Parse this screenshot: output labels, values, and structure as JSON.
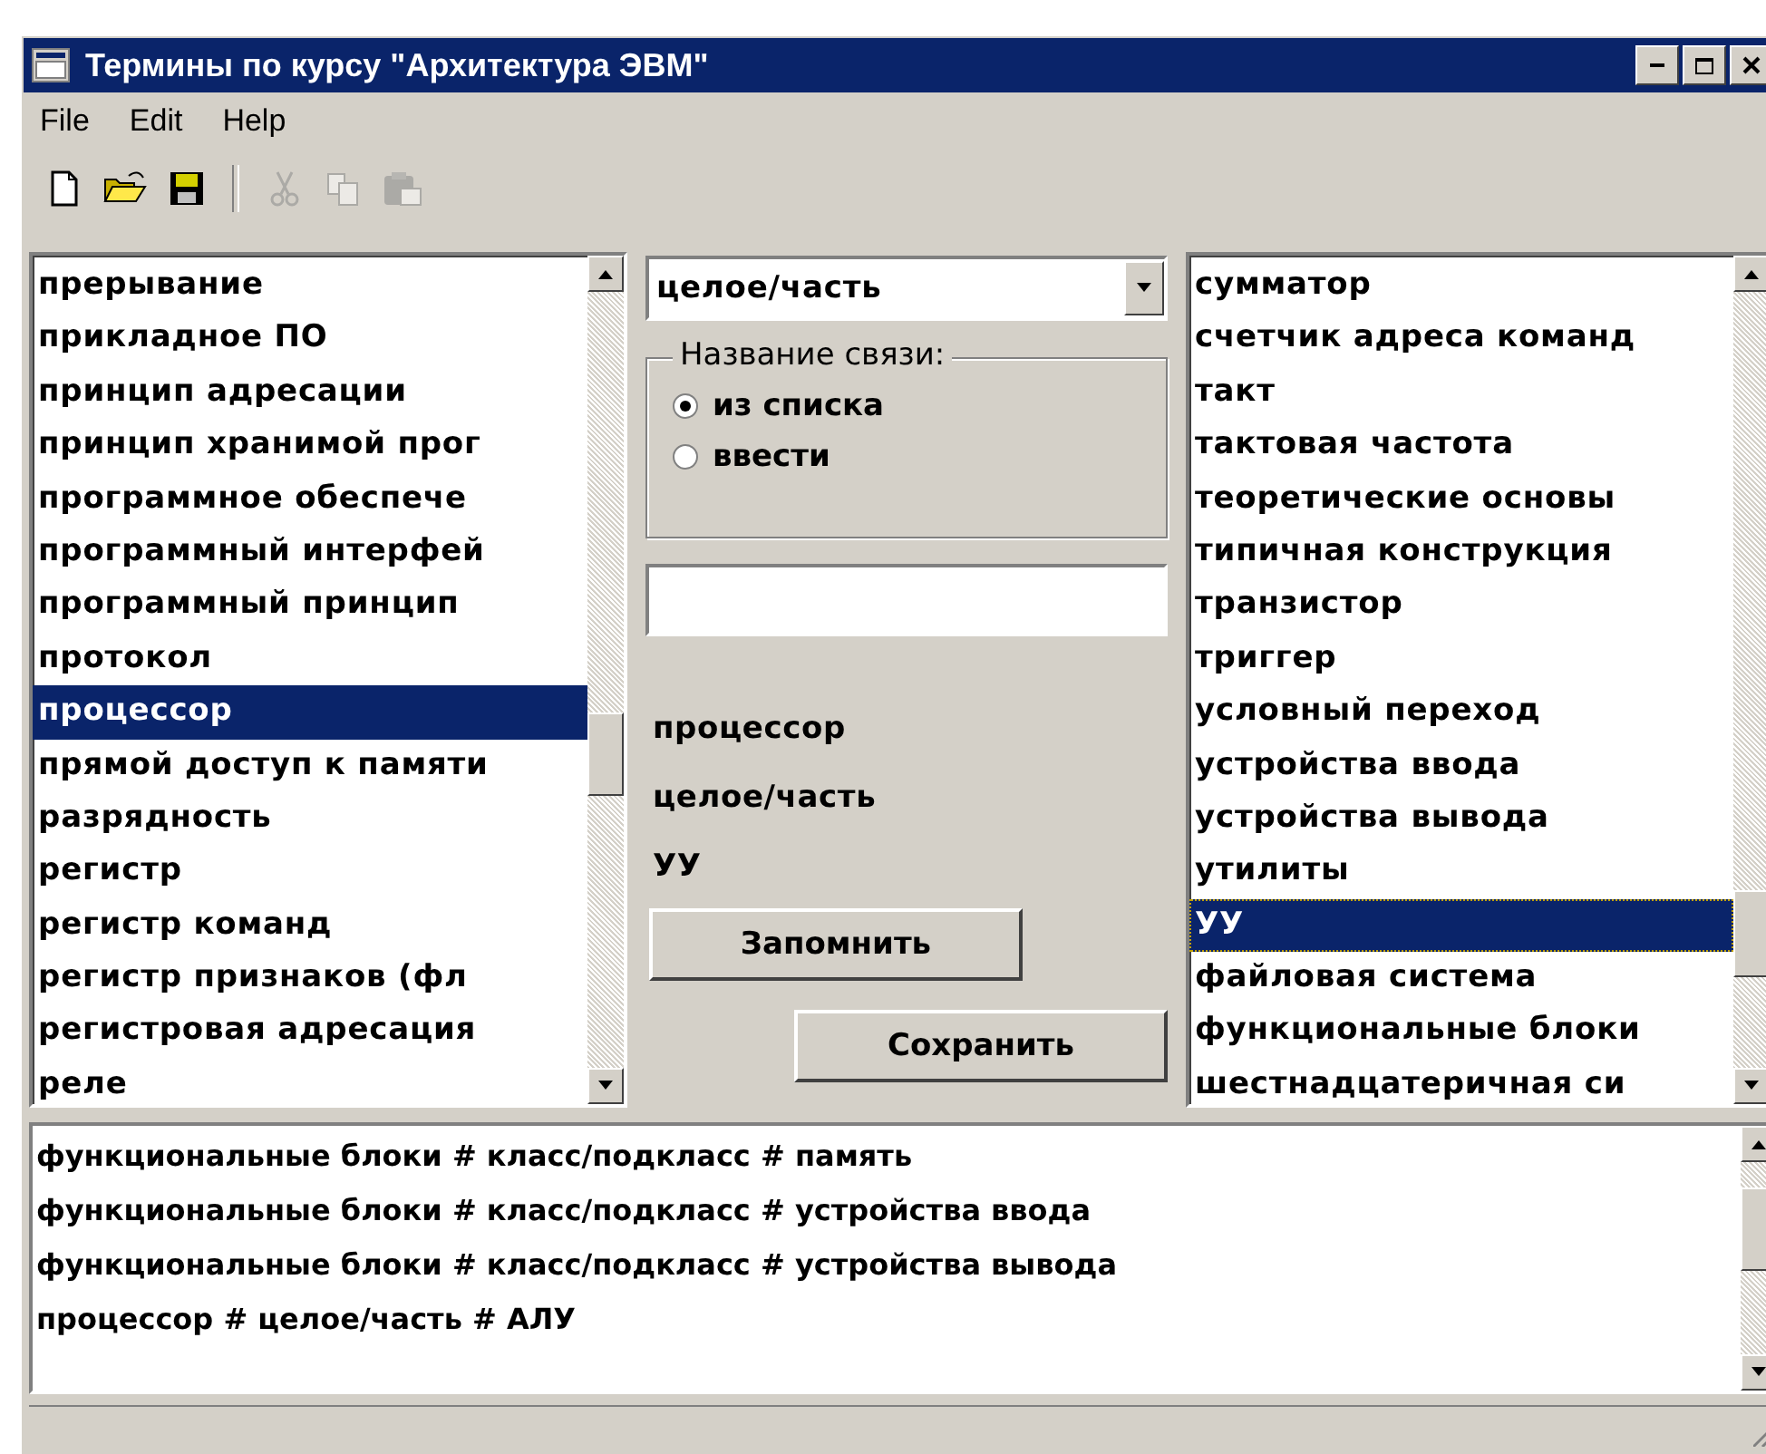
{
  "window": {
    "title": "Термины по курсу \"Архитектура ЭВМ\""
  },
  "menu": [
    "File",
    "Edit",
    "Help"
  ],
  "toolbar": [
    {
      "kind": "new",
      "disabled": false
    },
    {
      "kind": "open",
      "disabled": false
    },
    {
      "kind": "save",
      "disabled": false
    },
    {
      "kind": "separator"
    },
    {
      "kind": "cut",
      "disabled": true
    },
    {
      "kind": "copy",
      "disabled": true
    },
    {
      "kind": "paste",
      "disabled": true
    }
  ],
  "left_list": {
    "items": [
      {
        "label": "прерывание",
        "selected": false
      },
      {
        "label": "прикладное ПО",
        "selected": false
      },
      {
        "label": "принцип адресации",
        "selected": false
      },
      {
        "label": "принцип хранимой прог",
        "selected": false
      },
      {
        "label": "программное обеспече",
        "selected": false
      },
      {
        "label": "программный интерфей",
        "selected": false
      },
      {
        "label": "программный принцип",
        "selected": false
      },
      {
        "label": "протокол",
        "selected": false
      },
      {
        "label": "процессор",
        "selected": true
      },
      {
        "label": "прямой доступ к памяти",
        "selected": false
      },
      {
        "label": "разрядность",
        "selected": false
      },
      {
        "label": "регистр",
        "selected": false
      },
      {
        "label": "регистр команд",
        "selected": false
      },
      {
        "label": "регистр признаков (фл",
        "selected": false
      },
      {
        "label": "регистровая адресация",
        "selected": false
      },
      {
        "label": "реле",
        "selected": false
      }
    ]
  },
  "relation_combo": {
    "value": "целое/часть"
  },
  "relation_group": {
    "legend": "Название связи:",
    "options": [
      {
        "label": "из списка",
        "selected": true
      },
      {
        "label": "ввести",
        "selected": false
      }
    ]
  },
  "selection": [
    "процессор",
    "целое/часть",
    "УУ"
  ],
  "buttons": [
    {
      "label": "Запомнить"
    },
    {
      "label": "Сохранить"
    }
  ],
  "right_list": {
    "items": [
      {
        "label": "сумматор",
        "selected": false
      },
      {
        "label": "счетчик адреса команд",
        "selected": false
      },
      {
        "label": "такт",
        "selected": false
      },
      {
        "label": "тактовая частота",
        "selected": false
      },
      {
        "label": "теоретические основы",
        "selected": false
      },
      {
        "label": "типичная конструкция",
        "selected": false
      },
      {
        "label": "транзистор",
        "selected": false
      },
      {
        "label": "триггер",
        "selected": false
      },
      {
        "label": "условный переход",
        "selected": false
      },
      {
        "label": "устройства ввода",
        "selected": false
      },
      {
        "label": "устройства вывода",
        "selected": false
      },
      {
        "label": "утилиты",
        "selected": false
      },
      {
        "label": "УУ",
        "selected": true
      },
      {
        "label": "файловая система",
        "selected": false
      },
      {
        "label": "функциональные блоки",
        "selected": false
      },
      {
        "label": "шестнадцатеричная си",
        "selected": false
      }
    ]
  },
  "memo": {
    "lines": [
      "функциональные блоки # класс/подкласс # память",
      "функциональные блоки # класс/подкласс # устройства ввода",
      "функциональные блоки # класс/подкласс # устройства вывода",
      "процессор # целое/часть # АЛУ"
    ]
  }
}
